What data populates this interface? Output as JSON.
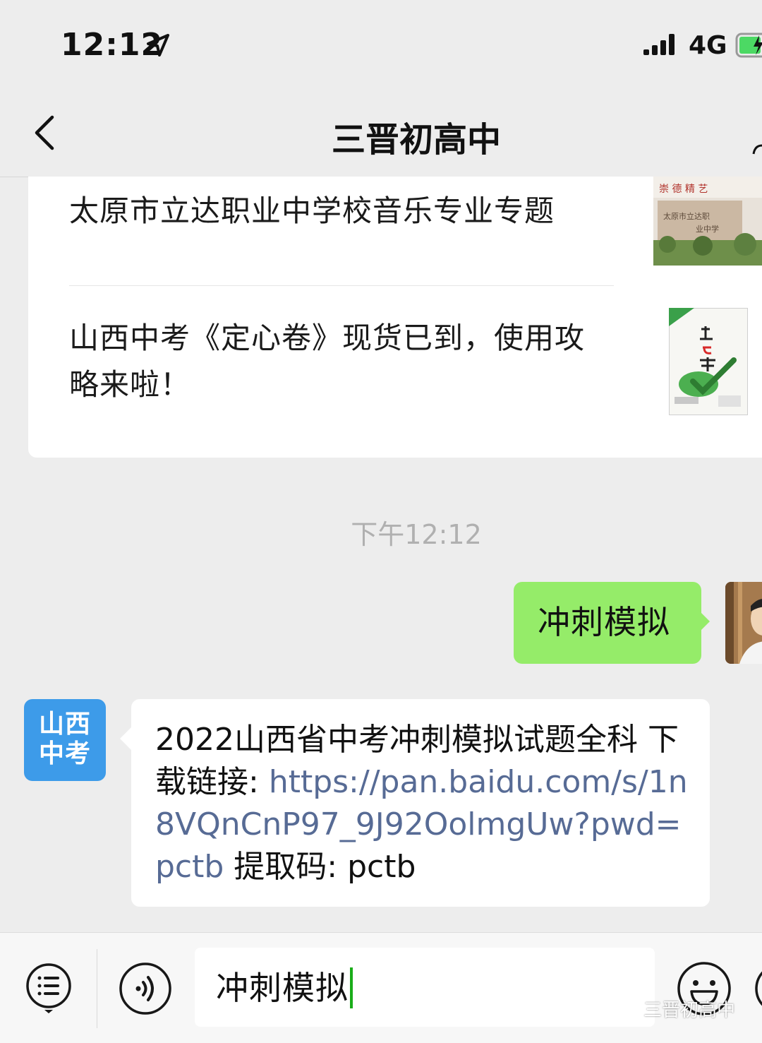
{
  "status_bar": {
    "time": "12:12",
    "network": "4G",
    "icons": [
      "location-arrow-icon",
      "signal-bars-icon",
      "battery-charging-icon"
    ]
  },
  "nav": {
    "title": "三晋初高中",
    "icons": [
      "chevron-left-icon",
      "person-icon"
    ]
  },
  "articles": [
    {
      "title": "太原市立达职业中学校音乐专业专题"
    },
    {
      "title": "山西中考《定心卷》现货已到，使用攻略来啦！"
    }
  ],
  "chat": {
    "timestamp": "下午12:12",
    "sent_message": "冲刺模拟",
    "official_avatar_lines": [
      "山西",
      "中考"
    ],
    "received_message": {
      "text_before": "2022山西省中考冲刺模拟试题全科 下载链接: ",
      "link": "https://pan.baidu.com/s/1n8VQnCnP97_9J92OolmgUw?pwd=pctb",
      "text_after": " 提取码: pctb"
    }
  },
  "input_bar": {
    "value": "冲刺模拟",
    "icons": [
      "menu-list-icon",
      "voice-icon",
      "emoji-icon",
      "plus-icon"
    ]
  },
  "watermark": "三晋初高中",
  "colors": {
    "background": "#ededed",
    "sent_bubble": "#95ec69",
    "link": "#576b95",
    "official_avatar": "#3d9be9",
    "caret": "#1aad19"
  }
}
